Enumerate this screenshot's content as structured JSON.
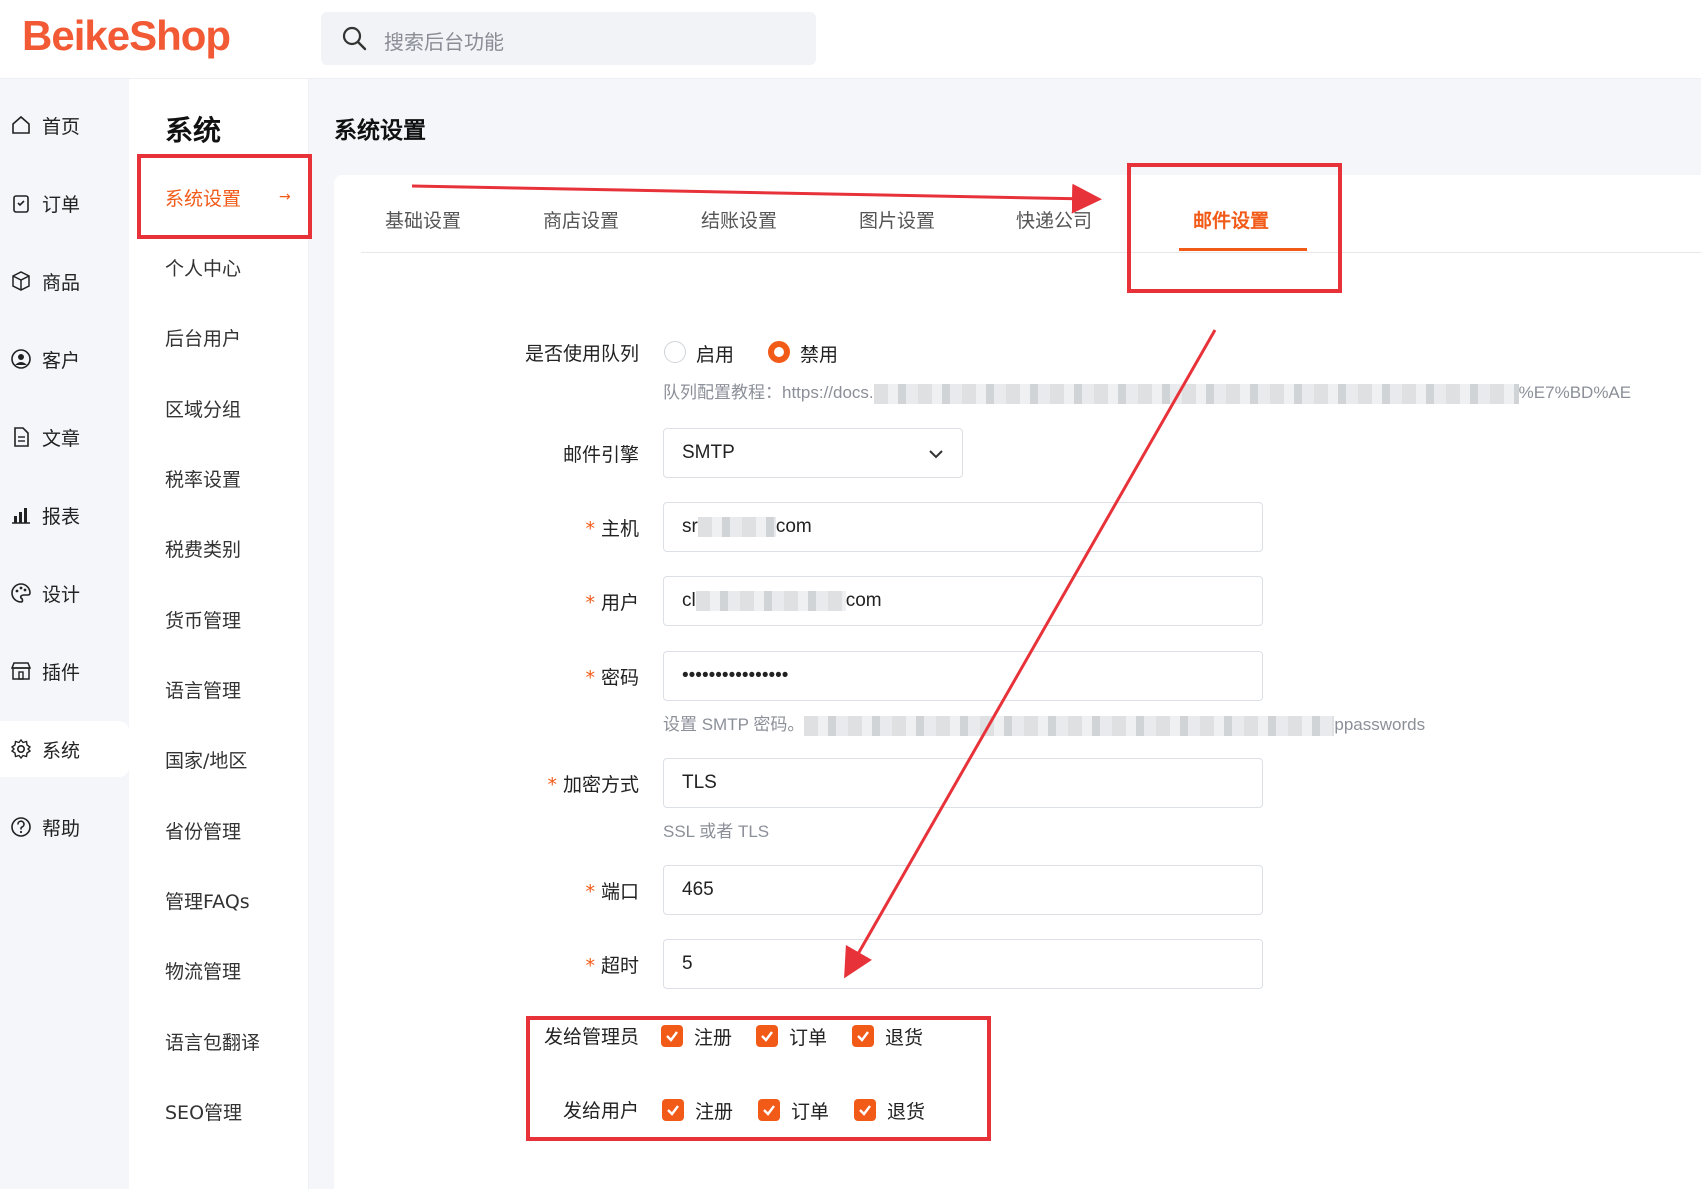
{
  "app": {
    "logo": "BeikeShop",
    "search_placeholder": "搜索后台功能"
  },
  "nav": {
    "items": [
      {
        "label": "首页",
        "icon": "home-icon"
      },
      {
        "label": "订单",
        "icon": "order-icon"
      },
      {
        "label": "商品",
        "icon": "box-icon"
      },
      {
        "label": "客户",
        "icon": "user-icon"
      },
      {
        "label": "文章",
        "icon": "document-icon"
      },
      {
        "label": "报表",
        "icon": "bar-chart-icon"
      },
      {
        "label": "设计",
        "icon": "palette-icon"
      },
      {
        "label": "插件",
        "icon": "store-icon"
      },
      {
        "label": "系统",
        "icon": "gear-icon"
      },
      {
        "label": "帮助",
        "icon": "help-icon"
      }
    ],
    "active": "系统"
  },
  "submenu": {
    "title": "系统",
    "items": [
      "系统设置",
      "个人中心",
      "后台用户",
      "区域分组",
      "税率设置",
      "税费类别",
      "货币管理",
      "语言管理",
      "国家/地区",
      "省份管理",
      "管理FAQs",
      "物流管理",
      "语言包翻译",
      "SEO管理"
    ],
    "active": "系统设置",
    "arrow": "→"
  },
  "page": {
    "title": "系统设置",
    "tabs": [
      "基础设置",
      "商店设置",
      "结账设置",
      "图片设置",
      "快递公司",
      "邮件设置"
    ],
    "active_tab": "邮件设置"
  },
  "form": {
    "queue": {
      "label": "是否使用队列",
      "options": [
        "启用",
        "禁用"
      ],
      "selected": "禁用",
      "hint_prefix": "队列配置教程：https://docs.",
      "hint_suffix": "%E7%BD%AE"
    },
    "engine": {
      "label": "邮件引擎",
      "value": "SMTP"
    },
    "host": {
      "label": "主机",
      "prefix": "sr",
      "suffix": "com"
    },
    "user": {
      "label": "用户",
      "prefix": "cl",
      "suffix": "com"
    },
    "password": {
      "label": "密码",
      "value": "••••••••••••••••",
      "hint_prefix": "设置 SMTP 密码。",
      "hint_suffix": "ppasswords"
    },
    "encryption": {
      "label": "加密方式",
      "value": "TLS",
      "hint": "SSL 或者 TLS"
    },
    "port": {
      "label": "端口",
      "value": "465"
    },
    "timeout": {
      "label": "超时",
      "value": "5"
    },
    "required_mark": "*",
    "notify_admin": {
      "label": "发给管理员",
      "options": [
        "注册",
        "订单",
        "退货"
      ]
    },
    "notify_user": {
      "label": "发给用户",
      "options": [
        "注册",
        "订单",
        "退货"
      ]
    }
  },
  "colors": {
    "accent": "#f25a18",
    "annotation": "#e8323a"
  }
}
